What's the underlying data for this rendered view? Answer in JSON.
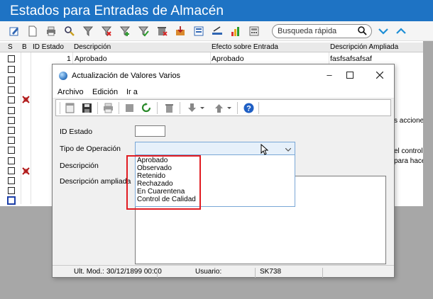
{
  "window": {
    "title": "Estados para Entradas de Almacén"
  },
  "search": {
    "placeholder": "Busqueda rápida"
  },
  "grid": {
    "headers": {
      "s": "S",
      "b": "B",
      "id": "ID Estado",
      "desc": "Descripción",
      "efecto": "Efecto sobre Entrada",
      "ampliada": "Descripción Ampliada"
    },
    "first_row": {
      "id": "1",
      "desc": "Aprobado",
      "efecto": "Aprobado",
      "ampliada": "fasfsafsafsaf"
    },
    "right_snippets": [
      "s acciones ar",
      "el control de",
      "para hacer u"
    ]
  },
  "dialog": {
    "title": "Actualización de Valores Varios",
    "menu": [
      "Archivo",
      "Edición",
      "Ir a"
    ],
    "fields": {
      "id_label": "ID Estado",
      "tipo_label": "Tipo de Operación",
      "desc_label": "Descripción",
      "ampliada_label": "Descripción ampliada"
    },
    "dropdown_options": [
      "Aprobado",
      "Observado",
      "Retenido",
      "Rechazado",
      "En Cuarentena",
      "Control de Calidad"
    ],
    "status": {
      "ult_mod_label": "Ult. Mod.:",
      "ult_mod_value": "30/12/1899 00:00",
      "usuario_label": "Usuario:",
      "usuario_value": "SK738"
    }
  },
  "colors": {
    "titlebar": "#1e73c4",
    "highlight": "#e11c22",
    "chevron": "#1e8fd6"
  }
}
